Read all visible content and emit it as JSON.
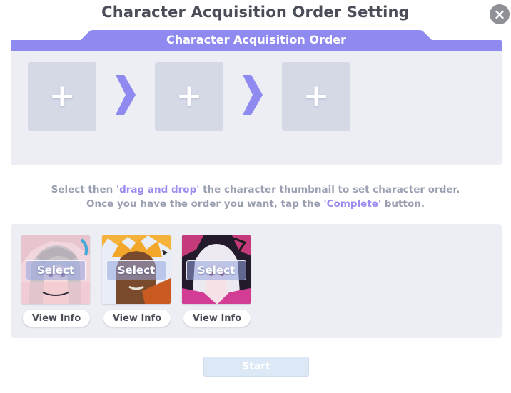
{
  "dialog": {
    "title": "Character Acquisition Order Setting",
    "close_icon": "close-icon",
    "close_glyph": "×"
  },
  "order": {
    "header": "Character Acquisition Order",
    "slots": [
      {
        "icon": "plus-icon",
        "glyph": "+"
      },
      {
        "icon": "plus-icon",
        "glyph": "+"
      },
      {
        "icon": "plus-icon",
        "glyph": "+"
      }
    ],
    "arrow_icon": "chevron-right-icon"
  },
  "instructions": {
    "line1_a": "Select then ",
    "line1_hl": "'drag and drop'",
    "line1_b": " the character thumbnail to set character order.",
    "line2_a": "Once you have the order you want, tap the ",
    "line2_hl": "'Complete'",
    "line2_b": " button."
  },
  "characters": [
    {
      "select_label": "Select",
      "info_label": "View Info"
    },
    {
      "select_label": "Select",
      "info_label": "View Info"
    },
    {
      "select_label": "Select",
      "info_label": "View Info"
    }
  ],
  "actions": {
    "start_label": "Start",
    "start_enabled": false
  },
  "colors": {
    "accent": "#8f8af0",
    "highlight_text": "#9b8df0",
    "panel_bg": "#eceef4",
    "slot_bg": "#d5d9e6",
    "start_disabled_bg": "#dde8f7"
  }
}
